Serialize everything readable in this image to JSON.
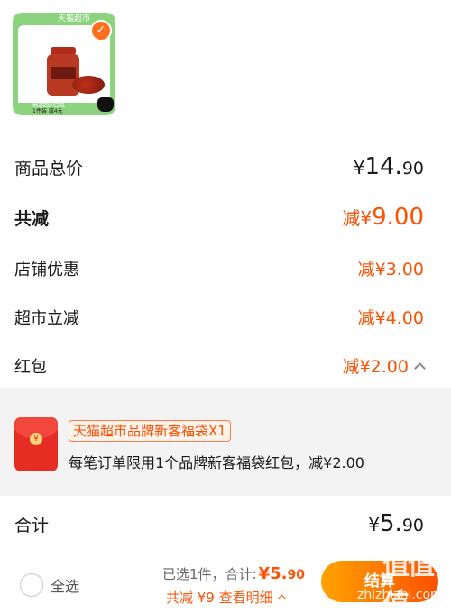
{
  "product": {
    "top_tag": "天猫超市",
    "bottom_line1": "地道四川口味",
    "bottom_line2": "1件装 减4元",
    "check_icon": "check-icon",
    "logo_icon": "tmall-cat-icon"
  },
  "price_rows": {
    "goods_total_label": "商品总价",
    "goods_total_yen": "¥",
    "goods_total_int": "14.",
    "goods_total_dec": "90",
    "total_reduce_label": "共减",
    "total_reduce_prefix": "减¥",
    "total_reduce_int": "9.",
    "total_reduce_dec": "00",
    "store_discount_label": "店铺优惠",
    "store_discount_value": "减¥3.00",
    "market_reduce_label": "超市立减",
    "market_reduce_value": "减¥4.00",
    "redpack_label": "红包",
    "redpack_value": "减¥2.00"
  },
  "redpack_detail": {
    "tag": "天猫超市品牌新客福袋X1",
    "description": "每笔订单限用1个品牌新客福袋红包，减¥2.00",
    "envelope_icon": "red-envelope-icon"
  },
  "total": {
    "label": "合计",
    "yen": "¥",
    "int": "5.",
    "dec": "90"
  },
  "bottom_bar": {
    "select_all": "全选",
    "selected_text": "已选1件，合计:",
    "amount_int": "¥5.",
    "amount_dec": "90",
    "savings_text": "共减 ¥9  查看明细",
    "checkout_label": "结算"
  },
  "watermark": {
    "logo": "值值值",
    "url": "zhizhizhi.com"
  },
  "colors": {
    "accent": "#ff5000",
    "card_green": "#8bd37d",
    "envelope_red": "#e52d24"
  }
}
